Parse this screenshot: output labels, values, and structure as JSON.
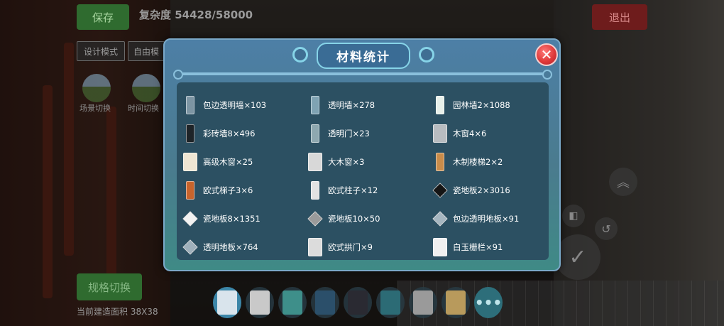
{
  "hud": {
    "save_label": "保存",
    "complexity_text": "复杂度 54428/58000",
    "exit_label": "退出",
    "mode_design": "设计模式",
    "mode_other": "自由模",
    "scene_labels": [
      "场景切换",
      "时间切换"
    ],
    "switch_label": "规格切换",
    "area_text": "当前建造面积 38X38"
  },
  "dialog": {
    "title": "材料统计",
    "close_symbol": "✕",
    "items": [
      {
        "label": "包边透明墙×103",
        "icon": "edged-glass-wall-icon",
        "color": "#7d95a3"
      },
      {
        "label": "透明墙×278",
        "icon": "glass-wall-icon",
        "color": "#7fa3b3"
      },
      {
        "label": "园林墙2×1088",
        "icon": "garden-wall-icon",
        "color": "#e8f0ea"
      },
      {
        "label": "彩砖墙8×496",
        "icon": "color-brick-wall-icon",
        "color": "#1e2428"
      },
      {
        "label": "透明门×23",
        "icon": "glass-door-icon",
        "color": "#8ea8b0"
      },
      {
        "label": "木窗4×6",
        "icon": "wood-window-icon",
        "color": "#b8bcc0"
      },
      {
        "label": "高级木窗×25",
        "icon": "premium-wood-window-icon",
        "color": "#efe6d3"
      },
      {
        "label": "大木窗×3",
        "icon": "large-wood-window-icon",
        "color": "#d8d8d8"
      },
      {
        "label": "木制楼梯2×2",
        "icon": "wood-stairs-icon",
        "color": "#c98c4a"
      },
      {
        "label": "欧式梯子3×6",
        "icon": "european-ladder-icon",
        "color": "#c8642c"
      },
      {
        "label": "欧式柱子×12",
        "icon": "european-pillar-icon",
        "color": "#e2e2e2"
      },
      {
        "label": "瓷地板2×3016",
        "icon": "ceramic-floor-dark-icon",
        "color": "#151515"
      },
      {
        "label": "瓷地板8×1351",
        "icon": "ceramic-floor-white-icon",
        "color": "#f2f2f2"
      },
      {
        "label": "瓷地板10×50",
        "icon": "ceramic-floor-grid-icon",
        "color": "#9a9a9a"
      },
      {
        "label": "包边透明地板×91",
        "icon": "edged-glass-floor-icon",
        "color": "#a6b6c0"
      },
      {
        "label": "透明地板×764",
        "icon": "glass-floor-icon",
        "color": "#9fb0bb"
      },
      {
        "label": "欧式拱门×9",
        "icon": "european-arch-icon",
        "color": "#dcdcdc"
      },
      {
        "label": "白玉栅栏×91",
        "icon": "white-jade-fence-icon",
        "color": "#f0f0f0"
      }
    ]
  },
  "toolbar": {
    "more_label": "•••",
    "tools": [
      {
        "icon": "eraser-icon",
        "color": "#d9e4ec"
      },
      {
        "icon": "white-wall-icon",
        "color": "#c9c9c9"
      },
      {
        "icon": "teal-arch-icon",
        "color": "#3e8f8a"
      },
      {
        "icon": "gothic-window-icon",
        "color": "#2b4f6a"
      },
      {
        "icon": "dark-frame-icon",
        "color": "#2a2a32"
      },
      {
        "icon": "teal-cabinet-icon",
        "color": "#2c6b75"
      },
      {
        "icon": "gray-door-icon",
        "color": "#9a9a9a"
      },
      {
        "icon": "wood-panel-icon",
        "color": "#b89a5c"
      }
    ]
  }
}
